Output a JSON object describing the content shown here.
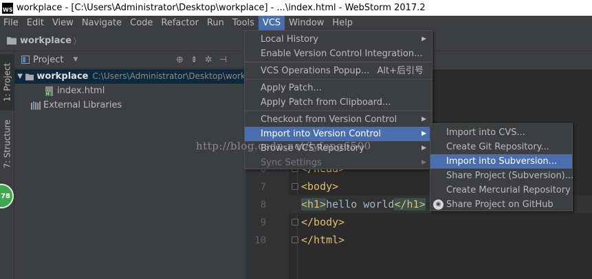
{
  "window": {
    "logo_text": "WS",
    "title": "workplace - [C:\\Users\\Administrator\\Desktop\\workplace] - ...\\index.html - WebStorm 2017.2"
  },
  "menubar": {
    "items": [
      "File",
      "Edit",
      "View",
      "Navigate",
      "Code",
      "Refactor",
      "Run",
      "Tools",
      "VCS",
      "Window",
      "Help"
    ],
    "active": "VCS"
  },
  "breadcrumb": {
    "project": "workplace"
  },
  "left_tabs": {
    "project": "1: Project",
    "structure": "7: Structure"
  },
  "badge": {
    "value": "78"
  },
  "project_panel": {
    "title": "Project",
    "tree": [
      {
        "name": "workplace",
        "path": "C:\\Users\\Administrator\\Desktop\\work"
      },
      {
        "name": "index.html"
      },
      {
        "name": "External Libraries"
      }
    ]
  },
  "editor": {
    "lines": [
      {
        "num": "6",
        "text": "</head>"
      },
      {
        "num": "7",
        "text": "<body>"
      },
      {
        "num": "8",
        "text_open": "<h1>",
        "text_body": "hello world",
        "text_close": "</h1>"
      },
      {
        "num": "9",
        "text": "</body>"
      },
      {
        "num": "10",
        "text": "</html>"
      }
    ]
  },
  "vcs_menu": {
    "items": [
      {
        "label": "Local History",
        "submenu": true
      },
      {
        "label": "Enable Version Control Integration..."
      },
      {
        "label": "VCS Operations Popup...",
        "shortcut": "Alt+后引号"
      },
      {
        "label": "Apply Patch..."
      },
      {
        "label": "Apply Patch from Clipboard..."
      },
      {
        "label": "Checkout from Version Control",
        "submenu": true
      },
      {
        "label": "Import into Version Control",
        "submenu": true,
        "active": true
      },
      {
        "label": "Browse VCS Repository",
        "submenu": true
      },
      {
        "label": "Sync Settings",
        "submenu": true,
        "disabled": true
      }
    ]
  },
  "import_menu": {
    "items": [
      {
        "label": "Import into CVS..."
      },
      {
        "label": "Create Git Repository..."
      },
      {
        "label": "Import into Subversion...",
        "active": true
      },
      {
        "label": "Share Project (Subversion)..."
      },
      {
        "label": "Create Mercurial Repository"
      },
      {
        "label": "Share Project on GitHub",
        "icon": "github-icon"
      }
    ]
  },
  "watermark": {
    "text": "http://blog.csdn.net/lyfeng6500"
  },
  "colors": {
    "menu_highlight": "#4b6eaf",
    "editor_bg": "#2b2b2b",
    "panel_bg": "#3c3f41",
    "tag": "#e8bf6a",
    "badge": "#3ea84e"
  }
}
